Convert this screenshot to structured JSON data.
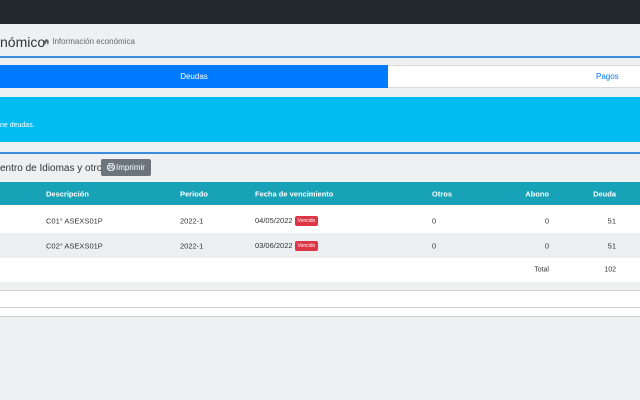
{
  "header": {
    "page_title": "nómico",
    "breadcrumb": "Información económica"
  },
  "tabs": {
    "active_label": "Deudas",
    "inactive_label": "Pagos"
  },
  "alert": {
    "text": "ne deudas."
  },
  "section": {
    "title": "entro de Idiomas y otros",
    "print_label": "Imprimir"
  },
  "table": {
    "headers": {
      "descripcion": "Descripción",
      "periodo": "Periodo",
      "vencimiento": "Fecha de vencimiento",
      "otros": "Otros",
      "abono": "Abono",
      "deuda": "Deuda"
    },
    "rows": [
      {
        "descripcion": "C01° ASEXS01P",
        "periodo": "2022-1",
        "vencimiento": "04/05/2022",
        "estado": "Vencido",
        "otros": "0",
        "abono": "0",
        "deuda": "51"
      },
      {
        "descripcion": "C02° ASEXS01P",
        "periodo": "2022-1",
        "vencimiento": "03/06/2022",
        "estado": "Vencido",
        "otros": "0",
        "abono": "0",
        "deuda": "51"
      }
    ],
    "total_label": "Total",
    "total_value": "102"
  },
  "colors": {
    "topbar": "#23282d",
    "primary": "#007bff",
    "info": "#00bcf0",
    "table_header": "#17a2b8",
    "danger": "#dc3545",
    "secondary": "#6c757d"
  },
  "icons": {
    "breadcrumb": "home-icon",
    "print": "print-icon"
  }
}
